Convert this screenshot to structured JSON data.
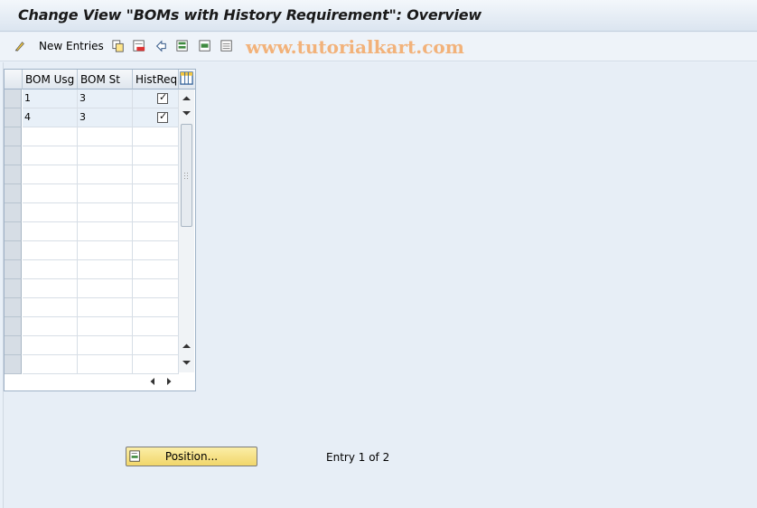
{
  "title": "Change View \"BOMs with History Requirement\": Overview",
  "toolbar": {
    "new_entries_label": "New Entries",
    "icons": [
      "pencil-glasses-icon",
      "copy-icon",
      "delete-icon",
      "undo-icon",
      "select-all-icon",
      "select-block-icon",
      "deselect-all-icon"
    ]
  },
  "watermark": "www.tutorialkart.com",
  "table": {
    "columns": [
      "BOM Usg",
      "BOM St",
      "HistReq"
    ],
    "rows": [
      {
        "bom_usg": "1",
        "bom_st": "3",
        "hist_req": true
      },
      {
        "bom_usg": "4",
        "bom_st": "3",
        "hist_req": true
      }
    ]
  },
  "footer": {
    "position_button": "Position...",
    "entry_info": "Entry 1 of 2"
  },
  "colors": {
    "title_bg": "#dbe5f0",
    "page_bg": "#e7eef6",
    "button_yellow": "#f1d66a",
    "watermark": "#f2b27a"
  }
}
